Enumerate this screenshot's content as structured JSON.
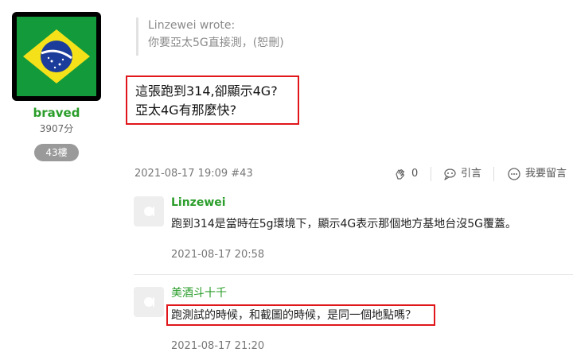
{
  "user": {
    "name": "braved",
    "points": "3907分",
    "floor": "43樓",
    "avatar_icon": "brazil-flag-icon"
  },
  "quote": {
    "author": "Linzewei wrote:",
    "text": "你要亞太5G直接測，(恕刪)"
  },
  "post": {
    "lines": [
      "這張跑到314,卻顯示4G?",
      "亞太4G有那麼快?"
    ],
    "highlight_color": "#e0161b"
  },
  "meta": {
    "timestamp": "2021-08-17 19:09 #43",
    "like_count": "0",
    "quote_label": "引言",
    "comment_label": "我要留言"
  },
  "comments": [
    {
      "author": "Linzewei",
      "text": "跑到314是當時在5g環境下，顯示4G表示那個地方基地台沒5G覆蓋。",
      "time": "2021-08-17 20:58"
    },
    {
      "author": "美酒斗十千",
      "text": "跑測試的時候，和截圖的時候，是同一個地點嗎？",
      "time": "2021-08-17 21:20"
    }
  ],
  "colors": {
    "accent_green": "#2a9d2a",
    "highlight_red": "#e0161b"
  }
}
